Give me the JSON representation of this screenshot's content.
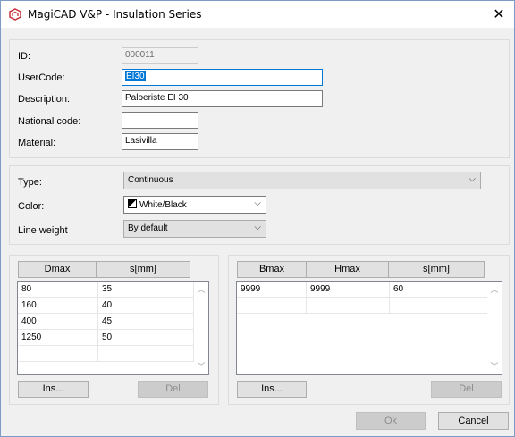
{
  "window": {
    "title": "MagiCAD V&P - Insulation Series",
    "icons": {
      "app": "magicad-logo-icon",
      "close": "close-icon"
    },
    "close_glyph": "✕"
  },
  "identity": {
    "id_label": "ID:",
    "id_value": "000011",
    "usercode_label": "UserCode:",
    "usercode_value": "EI30",
    "description_label": "Description:",
    "description_value": "Paloeriste EI 30",
    "national_code_label": "National code:",
    "national_code_value": "",
    "material_label": "Material:",
    "material_value": "Lasivilla"
  },
  "appearance": {
    "type_label": "Type:",
    "type_value": "Continuous",
    "color_label": "Color:",
    "color_value": "White/Black",
    "line_weight_label": "Line weight",
    "line_weight_value": "By default",
    "dropdown_icon": "chevron-down-icon",
    "chevron_glyph": "⌵"
  },
  "left_table": {
    "columns": [
      "Dmax",
      "s[mm]"
    ],
    "rows": [
      [
        "80",
        "35"
      ],
      [
        "160",
        "40"
      ],
      [
        "400",
        "45"
      ],
      [
        "1250",
        "50"
      ]
    ],
    "insert_label": "Ins...",
    "delete_label": "Del"
  },
  "right_table": {
    "columns": [
      "Bmax",
      "Hmax",
      "s[mm]"
    ],
    "rows": [
      [
        "9999",
        "9999",
        "60"
      ]
    ],
    "insert_label": "Ins...",
    "delete_label": "Del"
  },
  "scroll": {
    "up_glyph": "︿",
    "down_glyph": "﹀"
  },
  "footer": {
    "ok_label": "Ok",
    "cancel_label": "Cancel"
  }
}
